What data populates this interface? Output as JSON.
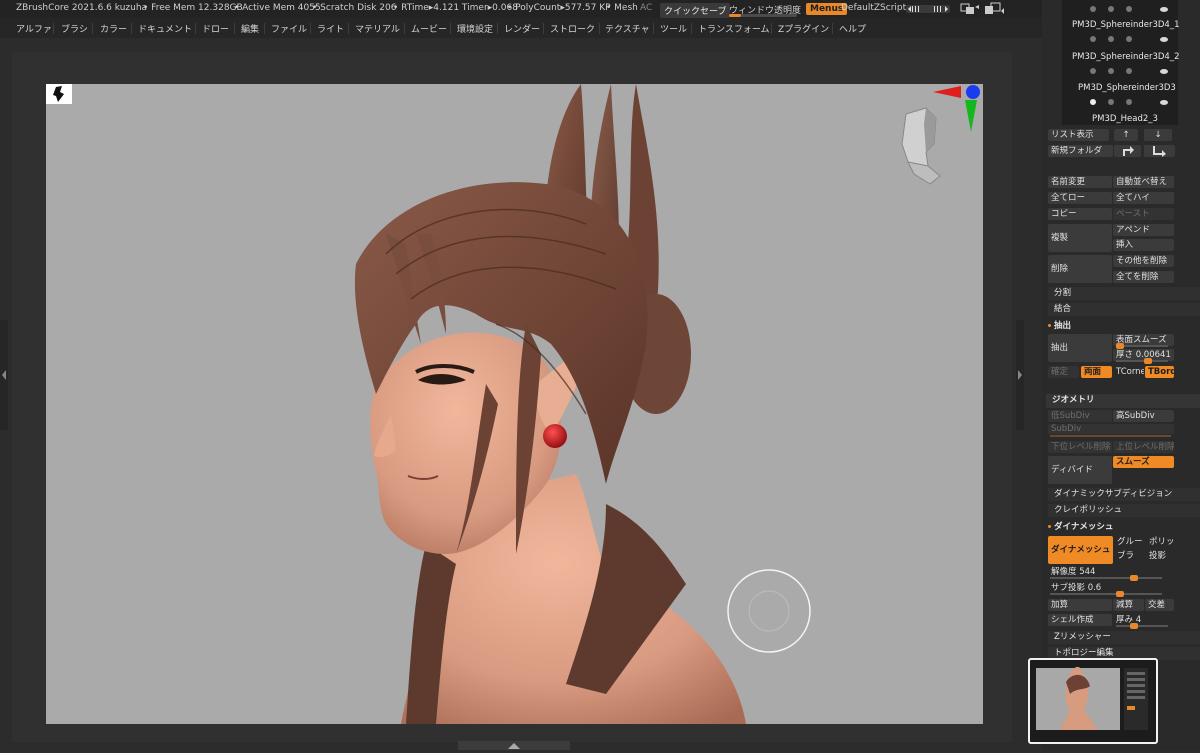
{
  "status_bar": {
    "app_title": "ZBrushCore 2021.6.6 kuzuha",
    "free_mem": "• Free Mem 12.328GB",
    "active_mem": "• Active Mem 4055",
    "scratch_disk": "• Scratch Disk 206",
    "rtime": "• RTime▸4.121 Timer▸0.068",
    "polycount": "• PolyCount▸577.57 KP",
    "mesh": "• Mesh",
    "ac": "AC",
    "quicksave": "クイックセーブ",
    "window_transparency": "ウィンドウ透明度",
    "menus": "Menus",
    "default_zscript": "DefaultZScript"
  },
  "menu_bar": {
    "items": [
      "アルファ",
      "ブラシ",
      "カラー",
      "ドキュメント",
      "ドロー",
      "編集",
      "ファイル",
      "ライト",
      "マテリアル",
      "ムービー",
      "環境設定",
      "レンダー",
      "ストローク",
      "テクスチャ",
      "ツール",
      "トランスフォーム",
      "Zプラグイン",
      "ヘルプ"
    ]
  },
  "colors": {
    "accent": "#f08a24",
    "background": "#2c2c2c",
    "viewport": "#aaaaaa",
    "hair": "#6e4638",
    "skin": "#d89a80",
    "earring": "#c0141a"
  },
  "subtools": {
    "items": [
      "PM3D_Sphereinder3D4_1",
      "PM3D_Sphereinder3D4_2",
      "PM3D_Sphereinder3D3",
      "PM3D_Head2_3"
    ]
  },
  "subtool_buttons": {
    "list_view": "リスト表示",
    "up_icon": "↑",
    "down_icon": "↓",
    "new_folder": "新規フォルダ",
    "rename": "名前変更",
    "auto_reorder": "自動並べ替え",
    "all_low": "全てロー",
    "all_high": "全てハイ",
    "copy": "コピー",
    "paste": "ペースト",
    "duplicate": "複製",
    "append": "アペンド",
    "insert": "挿入",
    "delete": "削除",
    "delete_other": "その他を削除",
    "delete_all": "全てを削除",
    "split": "分割",
    "merge": "結合"
  },
  "extract": {
    "header": "抽出",
    "extract_button": "抽出",
    "smooth_label": "表面スムーズ",
    "thickness_label": "厚さ 0.00641",
    "accept": "確定",
    "both_sides": "両面",
    "tcorner": "TCorne",
    "tborder": "TBorde"
  },
  "geometry": {
    "header": "ジオメトリ",
    "lower_subdiv": "低SubDiv",
    "higher_subdiv": "高SubDiv",
    "subdiv_label": "SubDiv",
    "del_lower": "下位レベル削除",
    "del_higher": "上位レベル削除",
    "divide": "ディバイド",
    "smooth": "スムーズ",
    "dynamic_subdiv": "ダイナミックサブディビジョン",
    "claypolish": "クレイポリッシュ"
  },
  "dynamesh": {
    "header": "ダイナメッシュ",
    "dynamesh_button": "ダイナメッシュ",
    "groups": "グルー",
    "polish": "ポリッ",
    "blur": "ブラ",
    "project": "投影",
    "resolution_label": "解像度 544",
    "resolution_value": 544,
    "subproject_label": "サブ投影 0.6",
    "subproject_value": 0.6,
    "add": "加算",
    "subtract": "減算",
    "intersect": "交差",
    "create_shell": "シェル作成",
    "thickness_label": "厚み 4",
    "thickness_value": 4
  },
  "more_sections": {
    "zremesher": "Zリメッシャー",
    "topology": "トポロジー編集"
  },
  "icons": {
    "document_logo": "brush-logo-icon",
    "head_gizmo": "head-gizmo-icon",
    "axis_gizmo": "axis-gizmo-icon",
    "lazy_mouse": "lazy-mouse-ring-icon"
  }
}
